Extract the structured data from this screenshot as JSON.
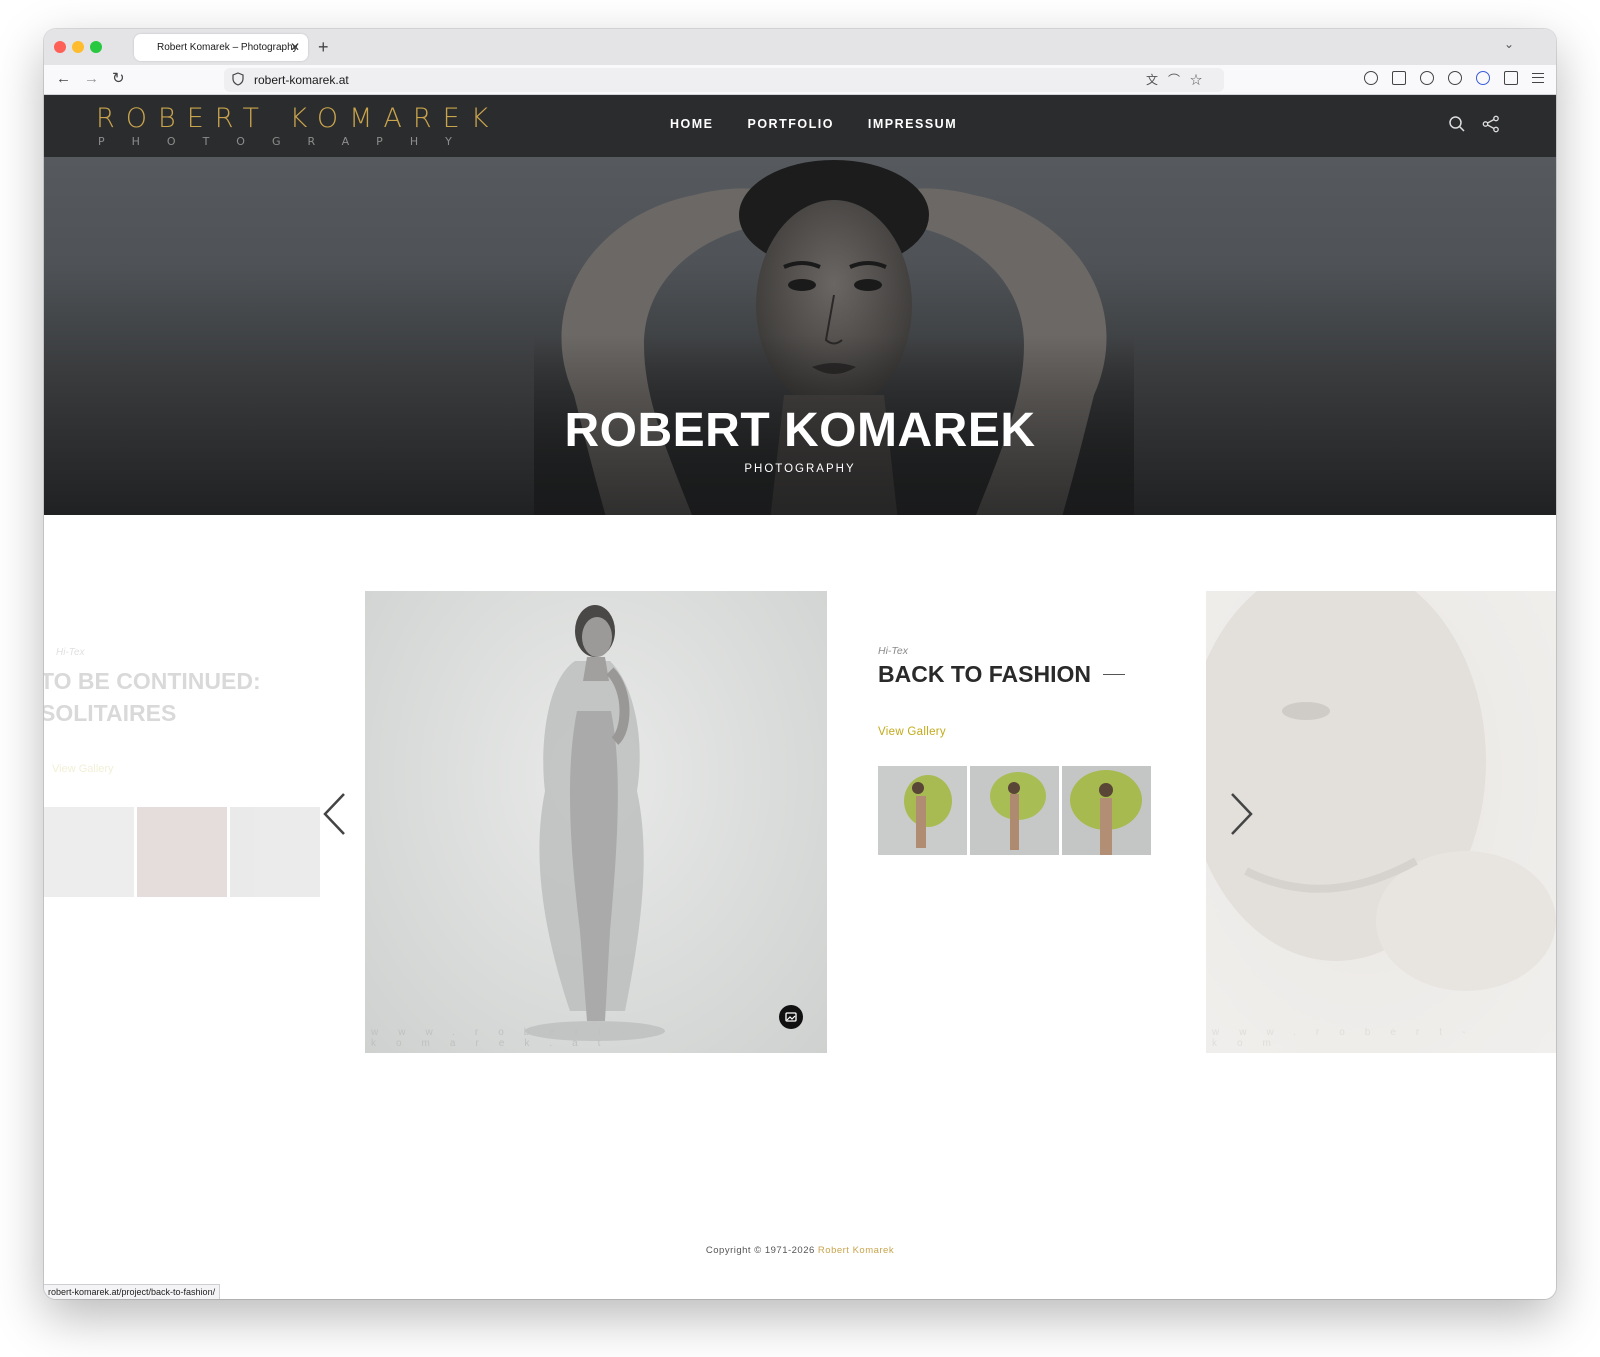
{
  "browser": {
    "tab_title": "Robert Komarek – Photography",
    "tab_close": "✕",
    "new_tab": "+",
    "tab_list": "⌄",
    "url": "robert-komarek.at",
    "back": "←",
    "forward": "→",
    "reload": "↻",
    "status_url": "robert-komarek.at/project/back-to-fashion/"
  },
  "site": {
    "logo_main": "ROBERT KOMAREK",
    "logo_sub": "PHOTOGRAPHY",
    "nav": [
      "HOME",
      "PORTFOLIO",
      "IMPRESSUM"
    ],
    "hero_title": "ROBERT KOMAREK",
    "hero_subtitle": "PHOTOGRAPHY",
    "accent_color": "#c9a44c",
    "link_color": "#c2aa1a"
  },
  "carousel": {
    "prev_slide": {
      "category": "Hi-Tex",
      "title": "TO BE CONTINUED: SOLITAIRES",
      "link": "View Gallery"
    },
    "current": {
      "category": "Hi-Tex",
      "title": "BACK TO FASHION",
      "link": "View Gallery",
      "watermark": "www.robert-komarek.at"
    },
    "next_slide": {
      "watermark": "www.robert-kom"
    }
  },
  "footer": {
    "copyright": "Copyright © 1971-2026",
    "owner": "Robert Komarek"
  }
}
